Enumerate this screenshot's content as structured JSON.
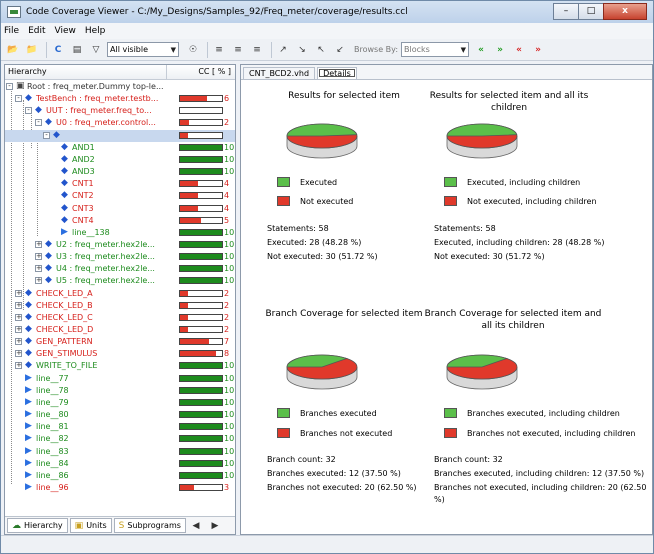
{
  "window": {
    "title": "Code Coverage Viewer - C:/My_Designs/Samples_92/Freq_meter/coverage/results.ccl",
    "buttons": {
      "minimize": "–",
      "maximize": "□",
      "close": "x"
    }
  },
  "menu": [
    "File",
    "Edit",
    "View",
    "Help"
  ],
  "toolbar": {
    "filter_value": "All visible",
    "browse_by_label": "Browse By:",
    "browse_by_value": "Blocks"
  },
  "left": {
    "header": {
      "hierarchy": "Hierarchy",
      "cc": "CC [ % ]"
    },
    "rows": [
      {
        "label": "Root : freq_meter.Dummy top-le...",
        "color": "blk",
        "pct": "",
        "fill": 0
      },
      {
        "label": "TestBench : freq_meter.testb...",
        "color": "red",
        "pct": "6",
        "fill": 0.65
      },
      {
        "label": "UUT : freq_meter.freq_to...",
        "color": "red",
        "pct": "",
        "fill": 0
      },
      {
        "label": "U0 : freq_meter.control...",
        "color": "red",
        "pct": "2",
        "fill": 0.22
      },
      {
        "label": "",
        "color": "red",
        "pct": "",
        "fill": 0.2
      },
      {
        "label": "AND1",
        "color": "green",
        "pct": "10",
        "fill": 1
      },
      {
        "label": "AND2",
        "color": "green",
        "pct": "10",
        "fill": 1
      },
      {
        "label": "AND3",
        "color": "green",
        "pct": "10",
        "fill": 1
      },
      {
        "label": "CNT1",
        "color": "red",
        "pct": "4",
        "fill": 0.42
      },
      {
        "label": "CNT2",
        "color": "red",
        "pct": "4",
        "fill": 0.42
      },
      {
        "label": "CNT3",
        "color": "red",
        "pct": "4",
        "fill": 0.42
      },
      {
        "label": "CNT4",
        "color": "red",
        "pct": "5",
        "fill": 0.5
      },
      {
        "label": "line__138",
        "color": "green",
        "pct": "10",
        "fill": 1
      },
      {
        "label": "U2 : freq_meter.hex2le...",
        "color": "green",
        "pct": "10",
        "fill": 1
      },
      {
        "label": "U3 : freq_meter.hex2le...",
        "color": "green",
        "pct": "10",
        "fill": 1
      },
      {
        "label": "U4 : freq_meter.hex2le...",
        "color": "green",
        "pct": "10",
        "fill": 1
      },
      {
        "label": "U5 : freq_meter.hex2le...",
        "color": "green",
        "pct": "10",
        "fill": 1
      },
      {
        "label": "CHECK_LED_A",
        "color": "red",
        "pct": "2",
        "fill": 0.2
      },
      {
        "label": "CHECK_LED_B",
        "color": "red",
        "pct": "2",
        "fill": 0.2
      },
      {
        "label": "CHECK_LED_C",
        "color": "red",
        "pct": "2",
        "fill": 0.2
      },
      {
        "label": "CHECK_LED_D",
        "color": "red",
        "pct": "2",
        "fill": 0.2
      },
      {
        "label": "GEN_PATTERN",
        "color": "red",
        "pct": "7",
        "fill": 0.7
      },
      {
        "label": "GEN_STIMULUS",
        "color": "red",
        "pct": "8",
        "fill": 0.85
      },
      {
        "label": "WRITE_TO_FILE",
        "color": "green",
        "pct": "10",
        "fill": 1
      },
      {
        "label": "line__77",
        "color": "green",
        "pct": "10",
        "fill": 1
      },
      {
        "label": "line__78",
        "color": "green",
        "pct": "10",
        "fill": 1
      },
      {
        "label": "line__79",
        "color": "green",
        "pct": "10",
        "fill": 1
      },
      {
        "label": "line__80",
        "color": "green",
        "pct": "10",
        "fill": 1
      },
      {
        "label": "line__81",
        "color": "green",
        "pct": "10",
        "fill": 1
      },
      {
        "label": "line__82",
        "color": "green",
        "pct": "10",
        "fill": 1
      },
      {
        "label": "line__83",
        "color": "green",
        "pct": "10",
        "fill": 1
      },
      {
        "label": "line__84",
        "color": "green",
        "pct": "10",
        "fill": 1
      },
      {
        "label": "line__86",
        "color": "green",
        "pct": "10",
        "fill": 1
      },
      {
        "label": "line__96",
        "color": "red",
        "pct": "3",
        "fill": 0.33
      }
    ],
    "tabs": [
      {
        "label": "Hierarchy",
        "icon": "hierarchy-icon"
      },
      {
        "label": "Units",
        "icon": "units-icon"
      },
      {
        "label": "Subprograms",
        "icon": "subprograms-icon"
      }
    ]
  },
  "right": {
    "tabs": [
      "CNT_BCD2.vhd",
      "Details"
    ],
    "statements": {
      "title_selected": "Results for selected item",
      "title_children": "Results for selected item and all its children",
      "legend_executed": "Executed",
      "legend_not_executed": "Not executed",
      "legend_executed_children": "Executed, including children",
      "legend_not_executed_children": "Not executed, including children",
      "sel_count": "Statements: 58",
      "sel_executed": "Executed: 28 (48.28 %)",
      "sel_not_executed": "Not executed: 30 (51.72 %)",
      "ch_count": "Statements: 58",
      "ch_executed": "Executed, including children: 28 (48.28 %)",
      "ch_not_executed": "Not executed: 30 (51.72 %)"
    },
    "branch": {
      "title_selected": "Branch Coverage for selected item",
      "title_children": "Branch Coverage for selected item and all its children",
      "legend_executed": "Branches executed",
      "legend_not_executed": "Branches not executed",
      "legend_executed_children": "Branches executed, including children",
      "legend_not_executed_children": "Branches not executed, including children",
      "sel_count": "Branch count: 32",
      "sel_executed": "Branches executed: 12 (37.50 %)",
      "sel_not_executed": "Branches not executed: 20 (62.50 %)",
      "ch_count": "Branch count: 32",
      "ch_executed": "Branches executed, including children: 12 (37.50 %)",
      "ch_not_executed": "Branches not executed, including children: 20 (62.50 %)"
    },
    "pies": [
      {
        "executed_fraction": 0.4828
      },
      {
        "executed_fraction": 0.4828
      },
      {
        "executed_fraction": 0.375
      },
      {
        "executed_fraction": 0.375
      }
    ]
  },
  "colors": {
    "executed": "#5bbf4a",
    "not_executed": "#e0392b",
    "tree_red": "#d6201b",
    "tree_green": "#1d8b1d"
  }
}
